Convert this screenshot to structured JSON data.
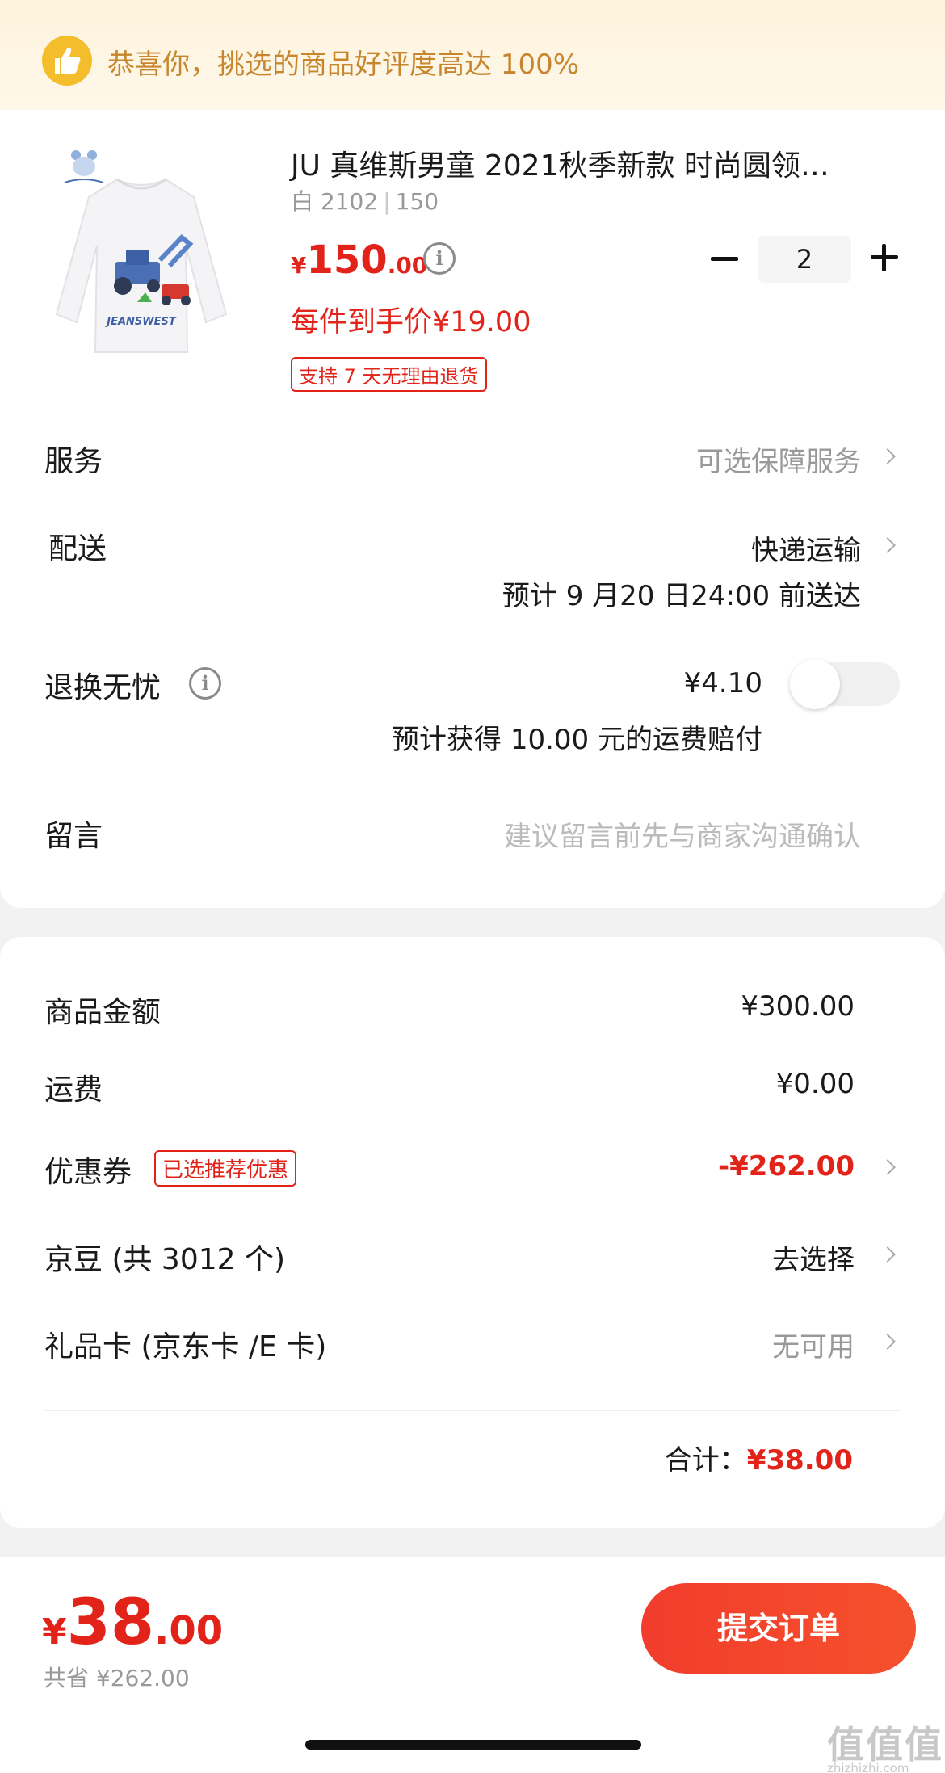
{
  "banner": {
    "text": "恭喜你，挑选的商品好评度高达 100%"
  },
  "product": {
    "title": "JU 真维斯男童 2021秋季新款 时尚圆领…",
    "color": "白 2102",
    "size": "150",
    "price_currency": "¥",
    "price_int": "150",
    "price_dec": ".00",
    "unit_price": "每件到手价¥19.00",
    "return_tag": "支持 7 天无理由退货",
    "quantity": "2",
    "image_logo_text": "JEANSWEST"
  },
  "rows": {
    "service_label": "服务",
    "service_value": "可选保障服务",
    "delivery_label": "配送",
    "delivery_value": "快递运输",
    "delivery_eta": "预计 9 月20 日24:00 前送达",
    "return_label": "退换无忧",
    "return_price": "¥4.10",
    "return_note": "预计获得 10.00 元的运费赔付",
    "message_label": "留言",
    "message_placeholder": "建议留言前先与商家沟通确认"
  },
  "summary": {
    "goods_label": "商品金额",
    "goods_value": "¥300.00",
    "shipping_label": "运费",
    "shipping_value": "¥0.00",
    "coupon_label": "优惠券",
    "coupon_tag": "已选推荐优惠",
    "coupon_value": "-¥262.00",
    "beans_label": "京豆 (共 3012 个)",
    "beans_value": "去选择",
    "giftcard_label": "礼品卡 (京东卡 /E 卡)",
    "giftcard_value": "无可用",
    "total_label": "合计：",
    "total_value": "¥38.00"
  },
  "footer": {
    "price_currency": "¥",
    "price_int": "38",
    "price_dec": ".00",
    "saved": "共省 ¥262.00",
    "submit_label": "提交订单",
    "watermark": "值值值",
    "watermark_sub": "zhizhizhi.com"
  },
  "icons": {
    "banner": "thumbs-up-icon",
    "info": "info-icon",
    "chevron": "chevron-right-icon"
  },
  "colors": {
    "accent_red": "#e2231a",
    "banner_text": "#c7862d",
    "banner_icon": "#f3bd2c"
  }
}
